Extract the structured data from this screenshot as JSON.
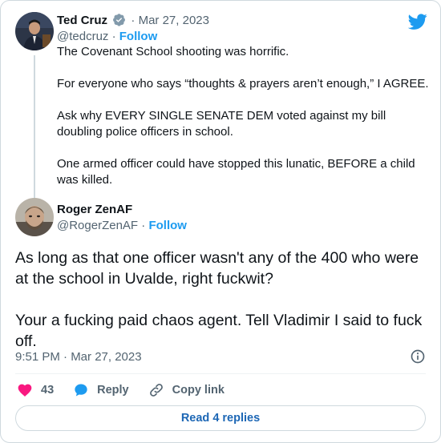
{
  "parent_tweet": {
    "author_name": "Ted Cruz",
    "date": "Mar 27, 2023",
    "separator": "·",
    "handle": "@tedcruz",
    "follow_label": "Follow",
    "paragraphs": [
      "The Covenant School shooting was horrific.",
      "For everyone who says “thoughts & prayers aren’t enough,” I AGREE.",
      "Ask why EVERY SINGLE SENATE DEM voted against my bill doubling police officers in school.",
      "One armed officer could have stopped this lunatic, BEFORE a child was killed."
    ]
  },
  "tweet": {
    "author_name": "Roger ZenAF",
    "handle": "@RogerZenAF",
    "separator": "·",
    "follow_label": "Follow",
    "paragraphs": [
      "As long as that one officer wasn't any of the 400 who were at the school in Uvalde, right fuckwit?",
      "Your a fucking paid chaos agent. Tell Vladimir I said to fuck off."
    ],
    "timestamp": "9:51 PM · Mar 27, 2023"
  },
  "actions": {
    "like_count": "43",
    "reply_label": "Reply",
    "copy_link_label": "Copy link"
  },
  "read_replies_label": "Read 4 replies",
  "icons": {
    "brand": "twitter-bird-icon",
    "verified": "verified-badge-icon",
    "info": "info-icon",
    "like": "heart-icon",
    "reply": "speech-bubble-icon",
    "copy": "link-icon"
  },
  "colors": {
    "brand_blue": "#1d9bf0",
    "like_red": "#f91880",
    "text": "#0f1419",
    "muted": "#536471",
    "border": "#cfd9de",
    "replies_blue": "#1d67b5"
  }
}
